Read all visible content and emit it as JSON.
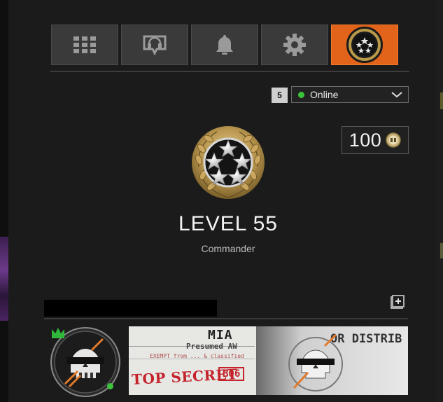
{
  "tabs": [
    {
      "name": "apps",
      "icon": "grid-icon",
      "active": false
    },
    {
      "name": "social",
      "icon": "headset-icon",
      "active": false
    },
    {
      "name": "notifications",
      "icon": "bell-icon",
      "active": false
    },
    {
      "name": "settings",
      "icon": "gear-icon",
      "active": false
    },
    {
      "name": "profile",
      "icon": "rank-icon",
      "active": true
    }
  ],
  "party": {
    "count": "5"
  },
  "status": {
    "label": "Online",
    "color": "#3bc43b"
  },
  "currency": {
    "value": "100",
    "icon": "cod-points-icon"
  },
  "player": {
    "level_text": "LEVEL 55",
    "rank": "Commander"
  },
  "calling_card": {
    "title": "MIA",
    "subtitle": "Presumed AW",
    "stamp": "TOP SECRET",
    "code": "B06",
    "corner_text": "OR DISTRIB",
    "scribble": "EXEMPT from ... & classified"
  },
  "colors": {
    "accent": "#e2631a",
    "online": "#3bc43b",
    "stamp_red": "#c4232b"
  }
}
